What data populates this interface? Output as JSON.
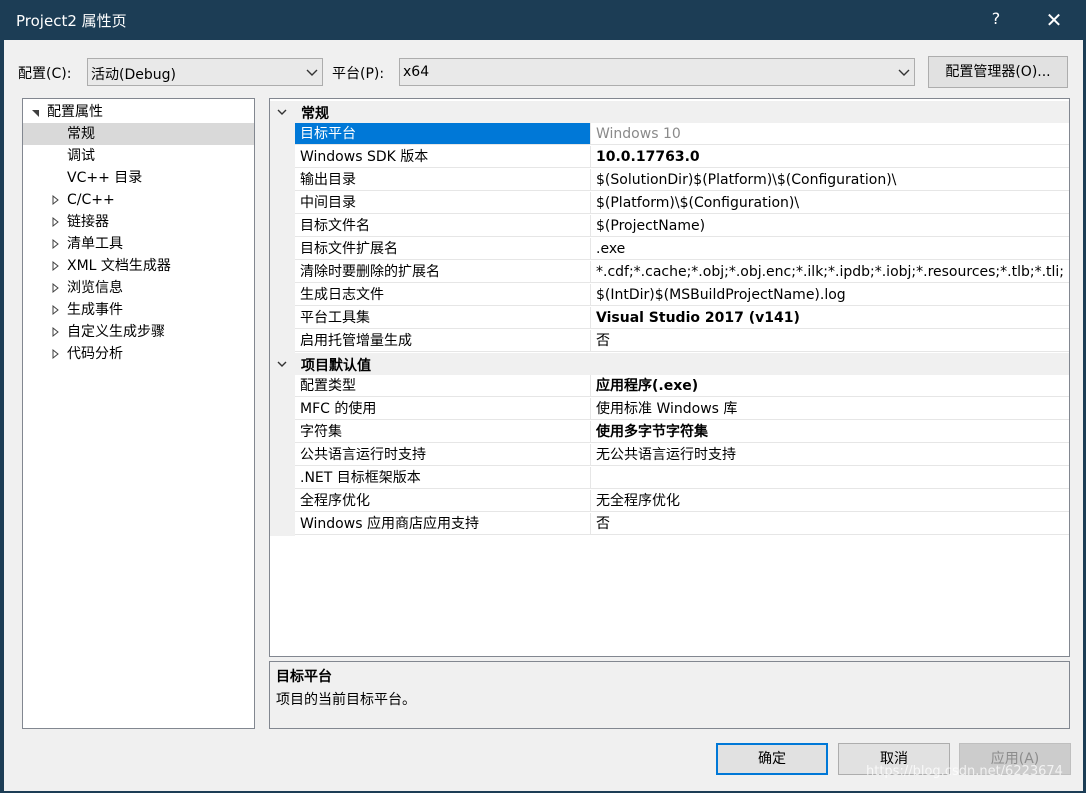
{
  "window": {
    "title": "Project2 属性页",
    "help_label": "?",
    "close_label": "✕"
  },
  "toolbar": {
    "config_label": "配置(C):",
    "config_value": "活动(Debug)",
    "platform_label": "平台(P):",
    "platform_value": "x64",
    "config_manager_label": "配置管理器(O)..."
  },
  "tree": {
    "items": [
      {
        "label": "配置属性"
      },
      {
        "label": "常规"
      },
      {
        "label": "调试"
      },
      {
        "label": "VC++ 目录"
      },
      {
        "label": "C/C++"
      },
      {
        "label": "链接器"
      },
      {
        "label": "清单工具"
      },
      {
        "label": "XML 文档生成器"
      },
      {
        "label": "浏览信息"
      },
      {
        "label": "生成事件"
      },
      {
        "label": "自定义生成步骤"
      },
      {
        "label": "代码分析"
      }
    ]
  },
  "grid": {
    "sections": [
      {
        "title": "常规",
        "rows": [
          {
            "name": "目标平台",
            "value": "Windows 10"
          },
          {
            "name": "Windows SDK 版本",
            "value": "10.0.17763.0"
          },
          {
            "name": "输出目录",
            "value": "$(SolutionDir)$(Platform)\\$(Configuration)\\"
          },
          {
            "name": "中间目录",
            "value": "$(Platform)\\$(Configuration)\\"
          },
          {
            "name": "目标文件名",
            "value": "$(ProjectName)"
          },
          {
            "name": "目标文件扩展名",
            "value": ".exe"
          },
          {
            "name": "清除时要删除的扩展名",
            "value": "*.cdf;*.cache;*.obj;*.obj.enc;*.ilk;*.ipdb;*.iobj;*.resources;*.tlb;*.tli;"
          },
          {
            "name": "生成日志文件",
            "value": "$(IntDir)$(MSBuildProjectName).log"
          },
          {
            "name": "平台工具集",
            "value": "Visual Studio 2017 (v141)"
          },
          {
            "name": "启用托管增量生成",
            "value": "否"
          }
        ]
      },
      {
        "title": "项目默认值",
        "rows": [
          {
            "name": "配置类型",
            "value": "应用程序(.exe)"
          },
          {
            "name": "MFC 的使用",
            "value": "使用标准 Windows 库"
          },
          {
            "name": "字符集",
            "value": "使用多字节字符集"
          },
          {
            "name": "公共语言运行时支持",
            "value": "无公共语言运行时支持"
          },
          {
            "name": ".NET 目标框架版本",
            "value": ""
          },
          {
            "name": "全程序优化",
            "value": "无全程序优化"
          },
          {
            "name": "Windows 应用商店应用支持",
            "value": "否"
          }
        ]
      }
    ]
  },
  "description": {
    "title": "目标平台",
    "text": "项目的当前目标平台。"
  },
  "buttons": {
    "ok_label": "确定",
    "cancel_label": "取消",
    "apply_label": "应用(A)"
  },
  "watermark": "https://blog.csdn.net/6223674",
  "colors": {
    "titlebar": "#1c3d55",
    "selection": "#0078d7",
    "tree_selection": "#d9d9d9"
  }
}
